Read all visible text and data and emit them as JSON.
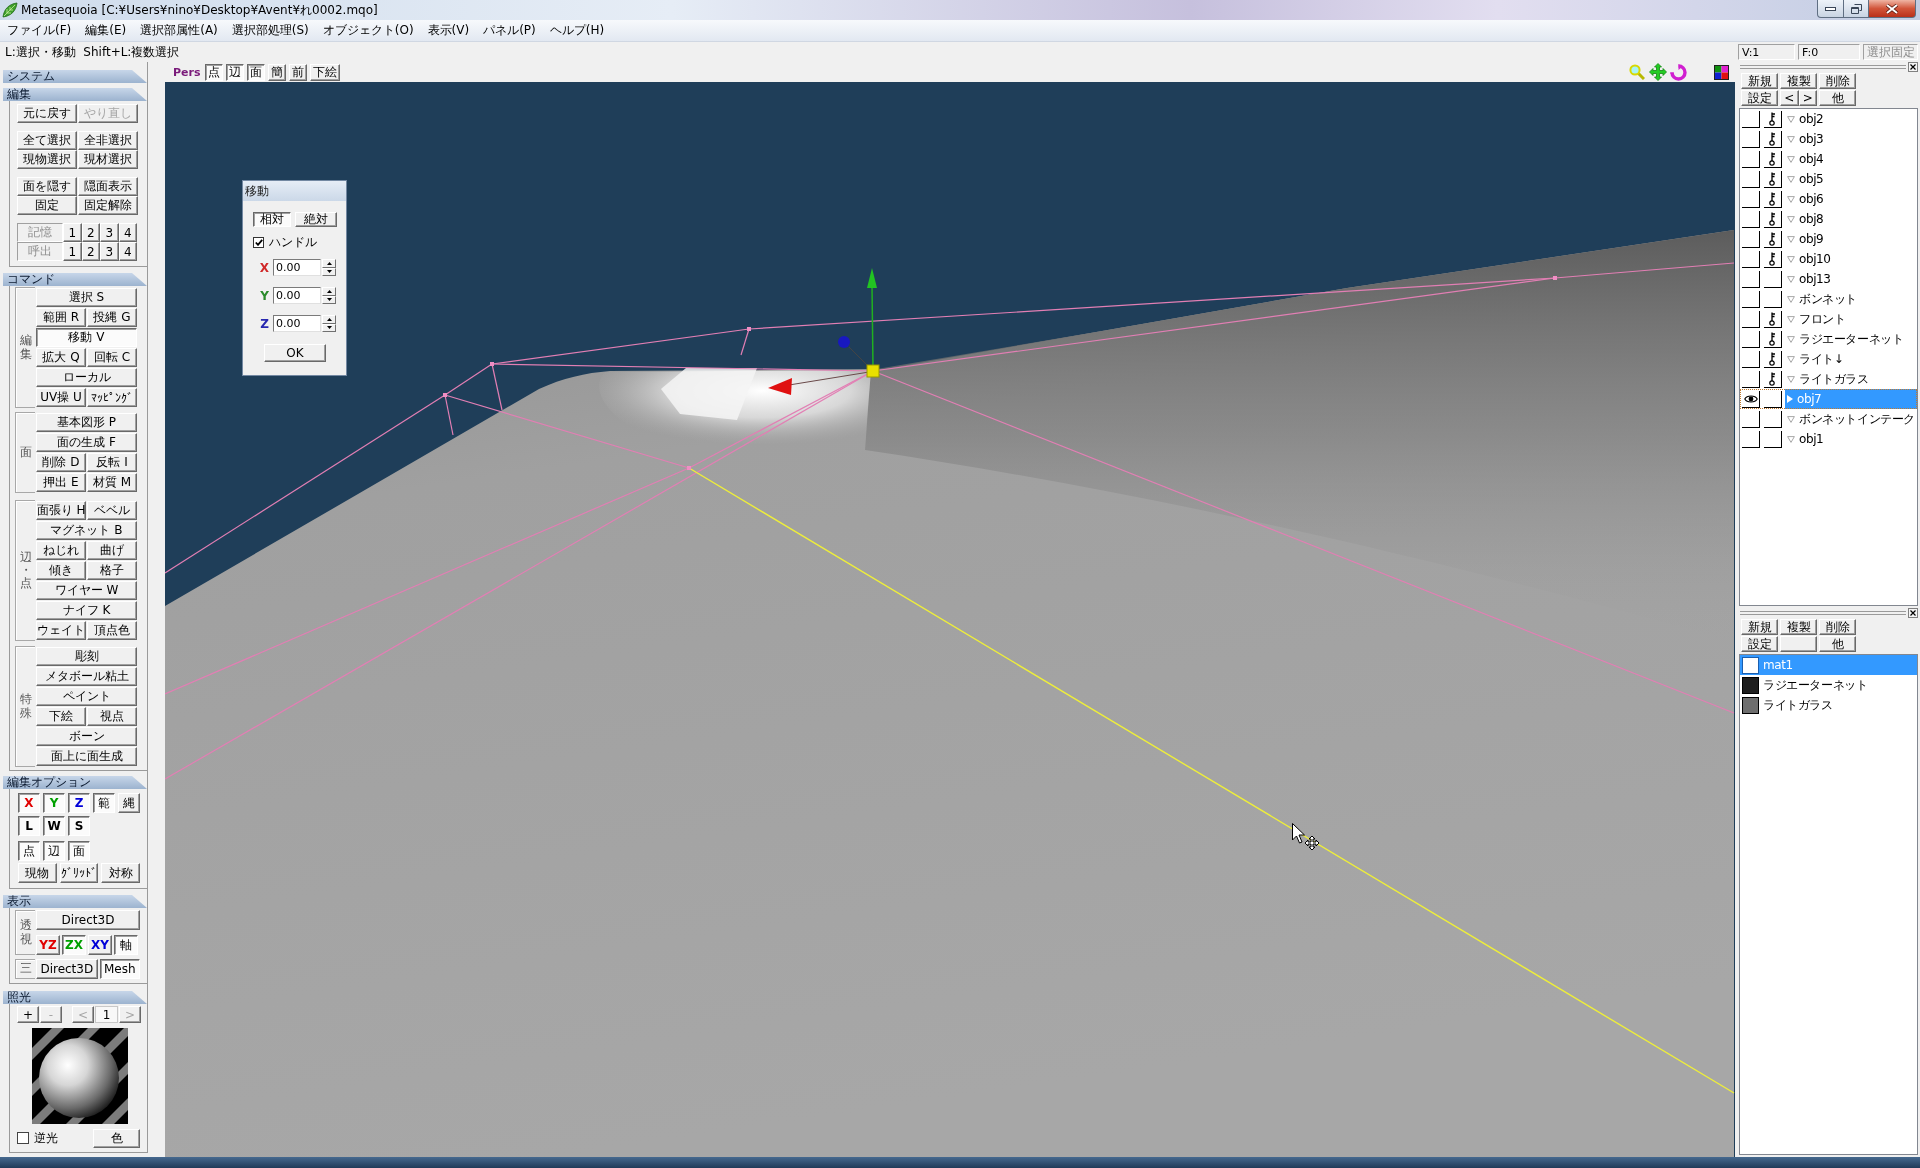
{
  "window": {
    "title": "Metasequoia [C:¥Users¥nino¥Desktop¥Avent¥れ0002.mqo]"
  },
  "menu": [
    "ファイル(F)",
    "編集(E)",
    "選択部属性(A)",
    "選択部処理(S)",
    "オブジェクト(O)",
    "表示(V)",
    "パネル(P)",
    "ヘルプ(H)"
  ],
  "status_bar": {
    "hint": "L:選択・移動  Shift+L:複数選択"
  },
  "left_panel": {
    "system": {
      "title": "システム"
    },
    "edit": {
      "title": "編集",
      "button_groups": [
        {
          "rows": [
            {
              "buttons": [
                {
                  "label": "元に戻す",
                  "disabled": false
                },
                {
                  "label": "やり直し",
                  "disabled": true
                }
              ]
            }
          ]
        },
        {
          "rows": [
            {
              "buttons": [
                {
                  "label": "全て選択",
                  "disabled": false
                },
                {
                  "label": "全非選択",
                  "disabled": false
                }
              ]
            },
            {
              "buttons": [
                {
                  "label": "現物選択",
                  "disabled": false
                },
                {
                  "label": "現材選択",
                  "disabled": false
                }
              ]
            }
          ]
        },
        {
          "rows": [
            {
              "buttons": [
                {
                  "label": "面を隠す",
                  "disabled": false
                },
                {
                  "label": "隠面表示",
                  "disabled": false
                }
              ]
            },
            {
              "buttons": [
                {
                  "label": "固定",
                  "disabled": false
                },
                {
                  "label": "固定解除",
                  "disabled": false
                }
              ]
            }
          ]
        }
      ],
      "memory_rows": [
        {
          "label": "記憶",
          "slots": [
            "1",
            "2",
            "3",
            "4"
          ]
        },
        {
          "label": "呼出",
          "slots": [
            "1",
            "2",
            "3",
            "4"
          ]
        }
      ]
    },
    "command": {
      "title": "コマンド",
      "groups": [
        {
          "label": "編集",
          "rows": [
            {
              "buttons": [
                {
                  "label": "選択 S",
                  "selected": false
                }
              ]
            },
            {
              "buttons": [
                {
                  "label": "範囲 R",
                  "selected": false
                },
                {
                  "label": "投縄 G",
                  "selected": false
                }
              ]
            },
            {
              "buttons": [
                {
                  "label": "移動 V",
                  "selected": true
                }
              ]
            },
            {
              "buttons": [
                {
                  "label": "拡大 Q",
                  "selected": false
                },
                {
                  "label": "回転 C",
                  "selected": false
                }
              ]
            },
            {
              "buttons": [
                {
                  "label": "ローカル",
                  "selected": false
                }
              ]
            },
            {
              "buttons": [
                {
                  "label": "UV操 U",
                  "selected": false
                },
                {
                  "label": "ﾏｯﾋﾟﾝｸﾞ",
                  "selected": false
                }
              ]
            }
          ]
        },
        {
          "label": "面",
          "rows": [
            {
              "buttons": [
                {
                  "label": "基本図形 P",
                  "selected": false
                }
              ]
            },
            {
              "buttons": [
                {
                  "label": "面の生成 F",
                  "selected": false
                }
              ]
            },
            {
              "buttons": [
                {
                  "label": "削除 D",
                  "selected": false
                },
                {
                  "label": "反転 I",
                  "selected": false
                }
              ]
            },
            {
              "buttons": [
                {
                  "label": "押出 E",
                  "selected": false
                },
                {
                  "label": "材質 M",
                  "selected": false
                }
              ]
            }
          ]
        },
        {
          "label": "辺・点",
          "rows": [
            {
              "buttons": [
                {
                  "label": "面張り H",
                  "selected": false
                },
                {
                  "label": "ベベル",
                  "selected": false
                }
              ]
            },
            {
              "buttons": [
                {
                  "label": "マグネット B",
                  "selected": false
                }
              ]
            },
            {
              "buttons": [
                {
                  "label": "ねじれ",
                  "selected": false
                },
                {
                  "label": "曲げ",
                  "selected": false
                }
              ]
            },
            {
              "buttons": [
                {
                  "label": "傾き",
                  "selected": false
                },
                {
                  "label": "格子",
                  "selected": false
                }
              ]
            },
            {
              "buttons": [
                {
                  "label": "ワイヤー W",
                  "selected": false
                }
              ]
            },
            {
              "buttons": [
                {
                  "label": "ナイフ K",
                  "selected": false
                }
              ]
            },
            {
              "buttons": [
                {
                  "label": "ウェイト",
                  "selected": false
                },
                {
                  "label": "頂点色",
                  "selected": false
                }
              ]
            }
          ]
        },
        {
          "label": "特殊",
          "rows": [
            {
              "buttons": [
                {
                  "label": "彫刻",
                  "selected": false
                }
              ]
            },
            {
              "buttons": [
                {
                  "label": "メタボール粘土",
                  "selected": false
                }
              ]
            },
            {
              "buttons": [
                {
                  "label": "ペイント",
                  "selected": false
                }
              ]
            },
            {
              "buttons": [
                {
                  "label": "下絵",
                  "selected": false
                },
                {
                  "label": "視点",
                  "selected": false
                }
              ]
            },
            {
              "buttons": [
                {
                  "label": "ボーン",
                  "selected": false
                }
              ]
            },
            {
              "buttons": [
                {
                  "label": "面上に面生成",
                  "selected": false
                }
              ]
            }
          ]
        }
      ]
    },
    "edit_options": {
      "title": "編集オプション",
      "rows": [
        {
          "buttons": [
            {
              "label": "X",
              "kind": "axis",
              "pressed": true,
              "color": "#e00000"
            },
            {
              "label": "Y",
              "kind": "axis",
              "pressed": true,
              "color": "#00a000"
            },
            {
              "label": "Z",
              "kind": "axis",
              "pressed": true,
              "color": "#0000d8"
            },
            {
              "label": "範",
              "kind": "square",
              "pressed": true
            },
            {
              "label": "縄",
              "kind": "square",
              "pressed": false
            }
          ]
        },
        {
          "buttons": [
            {
              "label": "L",
              "kind": "axis",
              "pressed": true
            },
            {
              "label": "W",
              "kind": "axis",
              "pressed": true
            },
            {
              "label": "S",
              "kind": "axis",
              "pressed": true
            }
          ]
        },
        {
          "buttons": [
            {
              "label": "点",
              "kind": "square",
              "pressed": true
            },
            {
              "label": "辺",
              "kind": "square",
              "pressed": true
            },
            {
              "label": "面",
              "kind": "square",
              "pressed": true
            }
          ]
        },
        {
          "buttons": [
            {
              "label": "現物",
              "kind": "wide",
              "pressed": false
            },
            {
              "label": "ｸﾞﾘｯﾄﾞ",
              "kind": "wide",
              "pressed": false
            },
            {
              "label": "対称",
              "kind": "wide",
              "pressed": false
            }
          ]
        }
      ]
    },
    "display": {
      "title": "表示",
      "groups": [
        {
          "label": "透視",
          "rows": [
            {
              "buttons": [
                {
                  "label": "Direct3D",
                  "kind": "wide",
                  "pressed": false
                }
              ]
            },
            {
              "buttons": [
                {
                  "label": "YZ",
                  "kind": "axis",
                  "pressed": false,
                  "color": "#e00000"
                },
                {
                  "label": "ZX",
                  "kind": "axis",
                  "pressed": true,
                  "color": "#00a000"
                },
                {
                  "label": "XY",
                  "kind": "axis",
                  "pressed": false,
                  "color": "#0000d8"
                },
                {
                  "label": "軸",
                  "kind": "square",
                  "pressed": true
                }
              ]
            }
          ]
        },
        {
          "label": "三",
          "rows": [
            {
              "buttons": [
                {
                  "label": "Direct3D",
                  "kind": "wide",
                  "pressed": false
                },
                {
                  "label": "Mesh",
                  "kind": "wide",
                  "pressed": true
                }
              ]
            }
          ]
        }
      ]
    },
    "lighting": {
      "title": "照光",
      "buttons": [
        {
          "label": "+",
          "disabled": false
        },
        {
          "label": "-",
          "disabled": true
        }
      ],
      "navigation": [
        {
          "label": "<",
          "disabled": true
        },
        {
          "label": ">",
          "disabled": true
        }
      ],
      "index": "1",
      "backlight": {
        "label": "逆光",
        "checked": false
      },
      "color_button": "色"
    }
  },
  "view_toolbar": {
    "projection": "Pers",
    "toggles": [
      {
        "label": "点",
        "pressed": true
      },
      {
        "label": "辺",
        "pressed": true
      },
      {
        "label": "面",
        "pressed": true
      },
      {
        "label": "簡",
        "pressed": false
      },
      {
        "label": "前",
        "pressed": false
      },
      {
        "label": "下絵",
        "pressed": false
      }
    ]
  },
  "move_dialog": {
    "title": "移動",
    "modes": [
      {
        "label": "相対",
        "selected": true
      },
      {
        "label": "絶対",
        "selected": false
      }
    ],
    "handle": {
      "label": "ハンドル",
      "checked": true
    },
    "fields": [
      {
        "axis": "X",
        "color": "#d02828",
        "value": "0.00"
      },
      {
        "axis": "Y",
        "color": "#2a8a2a",
        "value": "0.00"
      },
      {
        "axis": "Z",
        "color": "#2828b0",
        "value": "0.00"
      }
    ],
    "ok_label": "OK"
  },
  "right_panel": {
    "vertex_count": "V:1",
    "face_count": "F:0",
    "lock_button": {
      "label": "選択固定",
      "disabled": true
    },
    "object_panel": {
      "buttons": [
        {
          "cells": [
            {
              "kind": "button",
              "label": "新規"
            },
            {
              "kind": "button",
              "label": "複製"
            },
            {
              "kind": "button",
              "label": "削除"
            }
          ]
        },
        {
          "cells": [
            {
              "kind": "button",
              "label": "設定"
            },
            {
              "kind": "split",
              "labels": [
                "<",
                ">"
              ]
            },
            {
              "kind": "button",
              "label": "他"
            }
          ]
        }
      ],
      "objects": [
        {
          "name": "obj2",
          "visible": false,
          "locked": true,
          "selected": false
        },
        {
          "name": "obj3",
          "visible": false,
          "locked": true,
          "selected": false
        },
        {
          "name": "obj4",
          "visible": false,
          "locked": true,
          "selected": false
        },
        {
          "name": "obj5",
          "visible": false,
          "locked": true,
          "selected": false
        },
        {
          "name": "obj6",
          "visible": false,
          "locked": true,
          "selected": false
        },
        {
          "name": "obj8",
          "visible": false,
          "locked": true,
          "selected": false
        },
        {
          "name": "obj9",
          "visible": false,
          "locked": true,
          "selected": false
        },
        {
          "name": "obj10",
          "visible": false,
          "locked": true,
          "selected": false
        },
        {
          "name": "obj13",
          "visible": false,
          "locked": false,
          "selected": false
        },
        {
          "name": "ボンネット",
          "visible": false,
          "locked": false,
          "selected": false
        },
        {
          "name": "フロント",
          "visible": false,
          "locked": true,
          "selected": false
        },
        {
          "name": "ラジエーターネット",
          "visible": false,
          "locked": true,
          "selected": false
        },
        {
          "name": "ライト↓",
          "visible": false,
          "locked": true,
          "selected": false
        },
        {
          "name": "ライトガラス",
          "visible": false,
          "locked": true,
          "selected": false
        },
        {
          "name": "obj7",
          "visible": true,
          "locked": false,
          "selected": true
        },
        {
          "name": "ボンネットインテーク",
          "visible": false,
          "locked": false,
          "selected": false
        },
        {
          "name": "obj1",
          "visible": false,
          "locked": false,
          "selected": false
        }
      ]
    },
    "material_panel": {
      "buttons": [
        {
          "cells": [
            {
              "kind": "button",
              "label": "新規"
            },
            {
              "kind": "button",
              "label": "複製"
            },
            {
              "kind": "button",
              "label": "削除"
            }
          ]
        },
        {
          "cells": [
            {
              "kind": "button",
              "label": "設定"
            },
            {
              "kind": "blank"
            },
            {
              "kind": "button",
              "label": "他"
            }
          ]
        }
      ],
      "materials": [
        {
          "name": "mat1",
          "color": "#ffffff",
          "selected": true
        },
        {
          "name": "ラジエーターネット",
          "color": "#1e1e1e",
          "selected": false
        },
        {
          "name": "ライトガラス",
          "color": "#6e6e6e",
          "selected": false
        }
      ]
    }
  }
}
